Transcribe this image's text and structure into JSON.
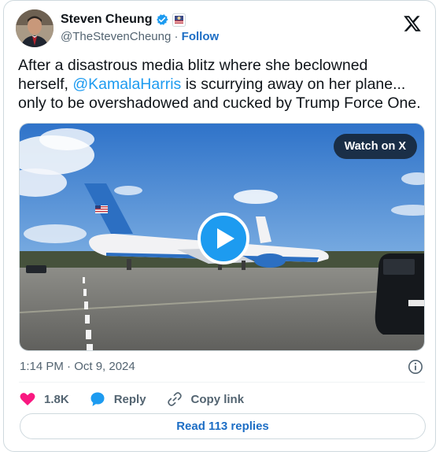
{
  "author": {
    "name": "Steven Cheung",
    "handle": "@TheStevenCheung",
    "separator": "·",
    "follow_label": "Follow"
  },
  "tweet": {
    "line1": "After a disastrous media blitz where she beclowned",
    "line2_prefix": "herself, ",
    "mention": "@KamalaHarris",
    "line2_suffix": " is scurrying away on her plane...",
    "line3": "only to be overshadowed and cucked by Trump Force One."
  },
  "media": {
    "watch_label": "Watch on X",
    "play_icon": "play-icon"
  },
  "meta": {
    "timestamp": "1:14 PM · Oct 9, 2024"
  },
  "actions": {
    "like_count": "1.8K",
    "reply_label": "Reply",
    "copy_link_label": "Copy link"
  },
  "read_replies_label": "Read 113 replies",
  "colors": {
    "accent": "#1d9bf0",
    "link": "#1d6ec5",
    "like": "#f91880",
    "muted": "#536471",
    "border": "#cfd9de"
  }
}
